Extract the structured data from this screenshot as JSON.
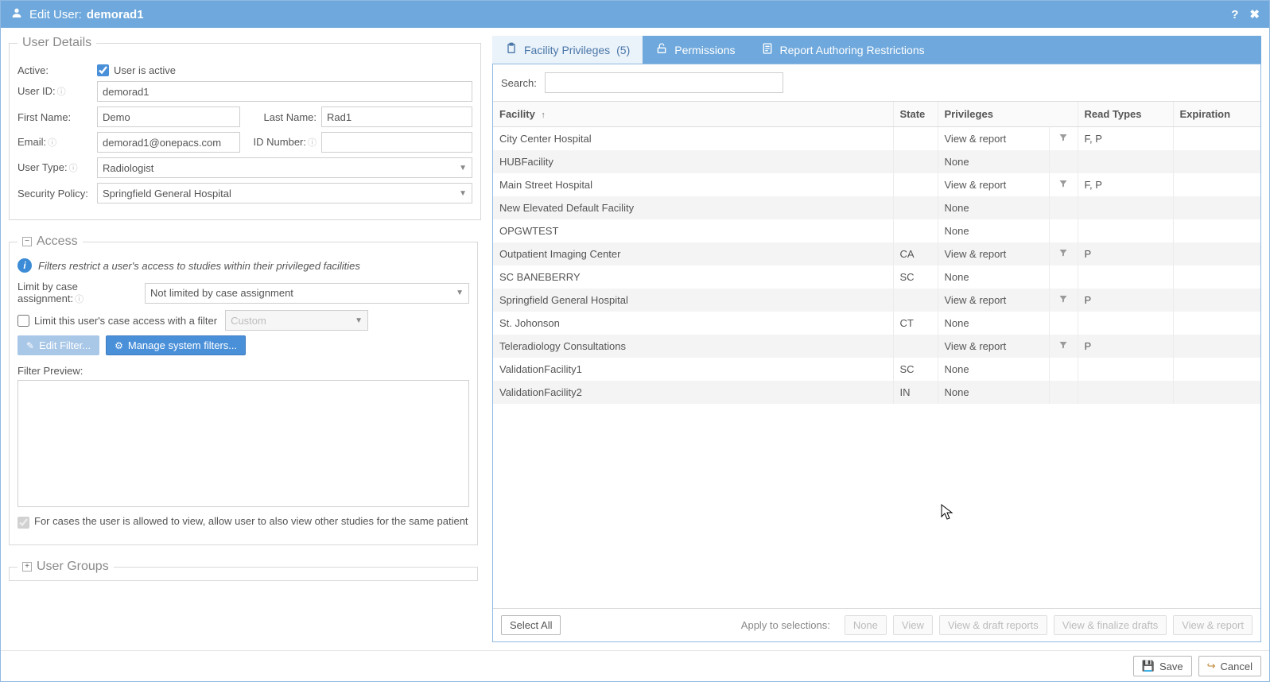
{
  "window": {
    "title_prefix": "Edit User:",
    "username": "demorad1"
  },
  "user_details": {
    "legend": "User Details",
    "active_label": "Active:",
    "active_check_label": "User is active",
    "active_checked": true,
    "user_id_label": "User ID:",
    "user_id_value": "demorad1",
    "first_name_label": "First Name:",
    "first_name_value": "Demo",
    "last_name_label": "Last Name:",
    "last_name_value": "Rad1",
    "email_label": "Email:",
    "email_value": "demorad1@onepacs.com",
    "id_number_label": "ID Number:",
    "id_number_value": "",
    "user_type_label": "User Type:",
    "user_type_value": "Radiologist",
    "security_policy_label": "Security Policy:",
    "security_policy_value": "Springfield General Hospital"
  },
  "access": {
    "legend": "Access",
    "info": "Filters restrict a user's access to studies within their privileged facilities",
    "limit_case_label": "Limit by case assignment:",
    "limit_case_value": "Not limited by case assignment",
    "limit_filter_check_label": "Limit this user's case access with a filter",
    "limit_filter_checked": false,
    "filter_dropdown_value": "Custom",
    "edit_filter_btn": "Edit Filter...",
    "manage_filters_btn": "Manage system filters...",
    "filter_preview_label": "Filter Preview:",
    "view_same_patient_label": "For cases the user is allowed to view, allow user to also view other studies for the same patient",
    "view_same_patient_checked": true
  },
  "user_groups": {
    "legend": "User Groups"
  },
  "tabs": {
    "facility_privileges": "Facility Privileges",
    "facility_privileges_count": "(5)",
    "permissions": "Permissions",
    "report_restrictions": "Report Authoring Restrictions"
  },
  "facility_panel": {
    "search_label": "Search:",
    "columns": {
      "facility": "Facility",
      "state": "State",
      "privileges": "Privileges",
      "read_types": "Read Types",
      "expiration": "Expiration"
    },
    "rows": [
      {
        "facility": "City Center Hospital",
        "state": "",
        "privileges": "View & report",
        "filter": true,
        "read_types": "F, P",
        "expiration": ""
      },
      {
        "facility": "HUBFacility",
        "state": "",
        "privileges": "None",
        "filter": false,
        "read_types": "",
        "expiration": ""
      },
      {
        "facility": "Main Street Hospital",
        "state": "",
        "privileges": "View & report",
        "filter": true,
        "read_types": "F, P",
        "expiration": ""
      },
      {
        "facility": "New Elevated Default Facility",
        "state": "",
        "privileges": "None",
        "filter": false,
        "read_types": "",
        "expiration": ""
      },
      {
        "facility": "OPGWTEST",
        "state": "",
        "privileges": "None",
        "filter": false,
        "read_types": "",
        "expiration": ""
      },
      {
        "facility": "Outpatient Imaging Center",
        "state": "CA",
        "privileges": "View & report",
        "filter": true,
        "read_types": "P",
        "expiration": ""
      },
      {
        "facility": "SC BANEBERRY",
        "state": "SC",
        "privileges": "None",
        "filter": false,
        "read_types": "",
        "expiration": ""
      },
      {
        "facility": "Springfield General Hospital",
        "state": "",
        "privileges": "View & report",
        "filter": true,
        "read_types": "P",
        "expiration": ""
      },
      {
        "facility": "St. Johonson",
        "state": "CT",
        "privileges": "None",
        "filter": false,
        "read_types": "",
        "expiration": ""
      },
      {
        "facility": "Teleradiology Consultations",
        "state": "",
        "privileges": "View & report",
        "filter": true,
        "read_types": "P",
        "expiration": ""
      },
      {
        "facility": "ValidationFacility1",
        "state": "SC",
        "privileges": "None",
        "filter": false,
        "read_types": "",
        "expiration": ""
      },
      {
        "facility": "ValidationFacility2",
        "state": "IN",
        "privileges": "None",
        "filter": false,
        "read_types": "",
        "expiration": ""
      }
    ],
    "select_all_btn": "Select All",
    "apply_label": "Apply to selections:",
    "apply_buttons": [
      "None",
      "View",
      "View & draft reports",
      "View & finalize drafts",
      "View & report"
    ]
  },
  "footer": {
    "save": "Save",
    "cancel": "Cancel"
  }
}
